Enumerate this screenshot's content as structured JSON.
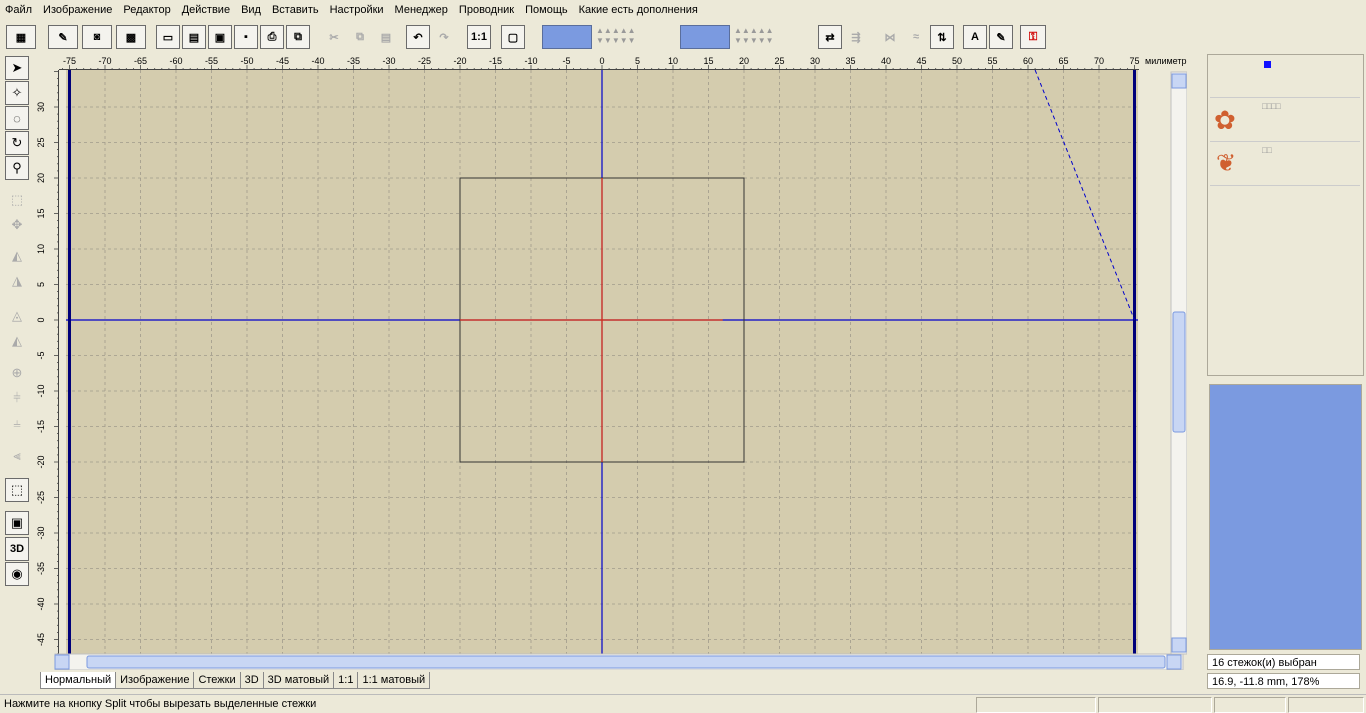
{
  "menu": [
    "Файл",
    "Изображение",
    "Редактор",
    "Действие",
    "Вид",
    "Вставить",
    "Настройки",
    "Менеджер",
    "Проводник",
    "Помощь",
    "Какие есть дополнения"
  ],
  "toolbar": {
    "one_to_one_label": "1:1",
    "text_tool_label": "A",
    "color_primary": "#7b9ae0",
    "color_secondary": "#7b9ae0"
  },
  "left_tools": {
    "view_3d_label": "3D"
  },
  "ruler": {
    "unit_label": "милиметр",
    "x_ticks": [
      -75,
      -70,
      -65,
      -60,
      -55,
      -50,
      -45,
      -40,
      -35,
      -30,
      -25,
      -20,
      -15,
      -10,
      -5,
      0,
      5,
      10,
      15,
      20,
      25,
      30,
      35,
      40,
      45,
      50,
      55,
      60,
      65,
      70,
      75
    ],
    "y_ticks": [
      30,
      25,
      20,
      15,
      10,
      5,
      0,
      -5,
      -10,
      -15,
      -20,
      -25,
      -30,
      -35,
      -40,
      -45
    ]
  },
  "canvas": {
    "background": "#d4ccae",
    "grid_color": "#a09a8c",
    "axis_color": "#0000cc",
    "selection_cross_color": "#e03010",
    "selection_rect_mm": {
      "x1": -20,
      "y1": 20,
      "x2": 20,
      "y2": -20
    },
    "boundary_mm": {
      "x_min": -75,
      "x_max": 75
    }
  },
  "tabs": [
    "Нормальный",
    "Изображение",
    "Стежки",
    "3D",
    "3D матовый",
    "1:1",
    "1:1 матовый"
  ],
  "active_tab": "Нормальный",
  "status": {
    "message": "Нажмите на кнопку Split чтобы вырезать выделенные стежки",
    "selection_info": "16 стежок(и) выбран",
    "cursor_info": "16.9, -11.8 mm, 178%"
  },
  "preview_color": "#7b9ae0"
}
